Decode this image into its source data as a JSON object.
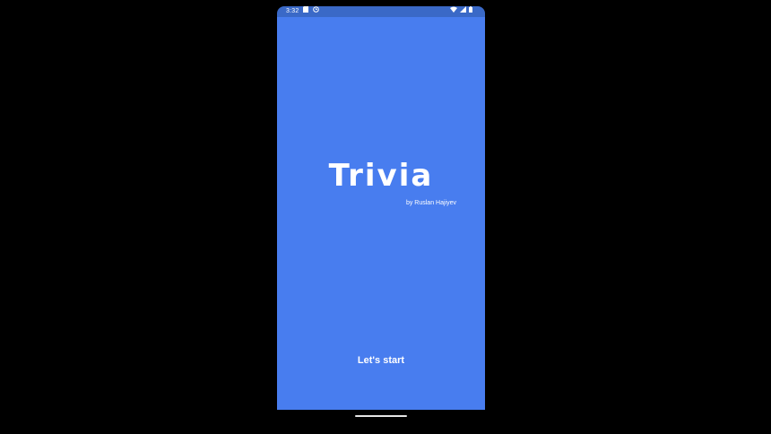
{
  "status_bar": {
    "time": "3:32",
    "left_icons": [
      "sd-card-icon",
      "clock-notification-icon"
    ],
    "right_icons": [
      "wifi-icon",
      "cellular-signal-icon",
      "battery-icon"
    ],
    "background_color": "#3a69c7"
  },
  "app": {
    "title": "Trivia",
    "byline": "by Ruslan Hajiyev",
    "start_button_label": "Let's start",
    "background_color": "#487def",
    "text_color": "#ffffff"
  },
  "navigation": {
    "home_indicator": "home-indicator"
  }
}
